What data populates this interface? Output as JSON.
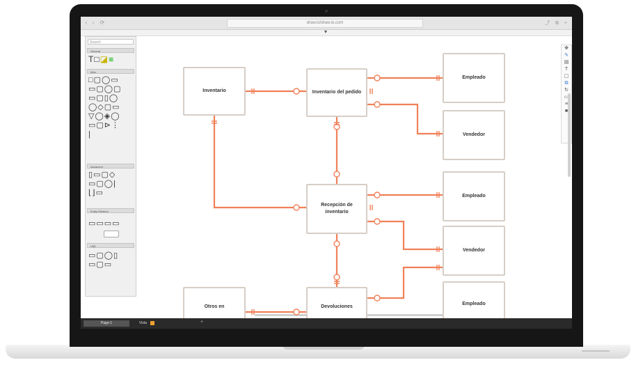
{
  "browser": {
    "url": "draw.io/draw.io.com",
    "nav": [
      "‹",
      "›",
      "⟳"
    ],
    "right_icons": "⤴ ⧉ +"
  },
  "sidebar": {
    "search_placeholder": "Search",
    "sections": [
      {
        "title": "General"
      },
      {
        "title": "Misc"
      },
      {
        "title": "Advanced"
      },
      {
        "title": "Entity Relation"
      },
      {
        "title": "UML"
      }
    ]
  },
  "diagram": {
    "entities": {
      "inventario": "Inventario",
      "inventario_pedido": "Inventario del pedido",
      "recepcion": "Recepción de inventario",
      "devoluciones": "Devoluciones",
      "otros": "Otros en",
      "empleado_1": "Empleado",
      "vendedor_1": "Vendedor",
      "empleado_2": "Empleado",
      "vendedor_2": "Vendedor",
      "empleado_3": "Empleado"
    },
    "link_color": "#f08058"
  },
  "status_bar": {
    "page_tab": "Page-1",
    "label": "Vista"
  }
}
